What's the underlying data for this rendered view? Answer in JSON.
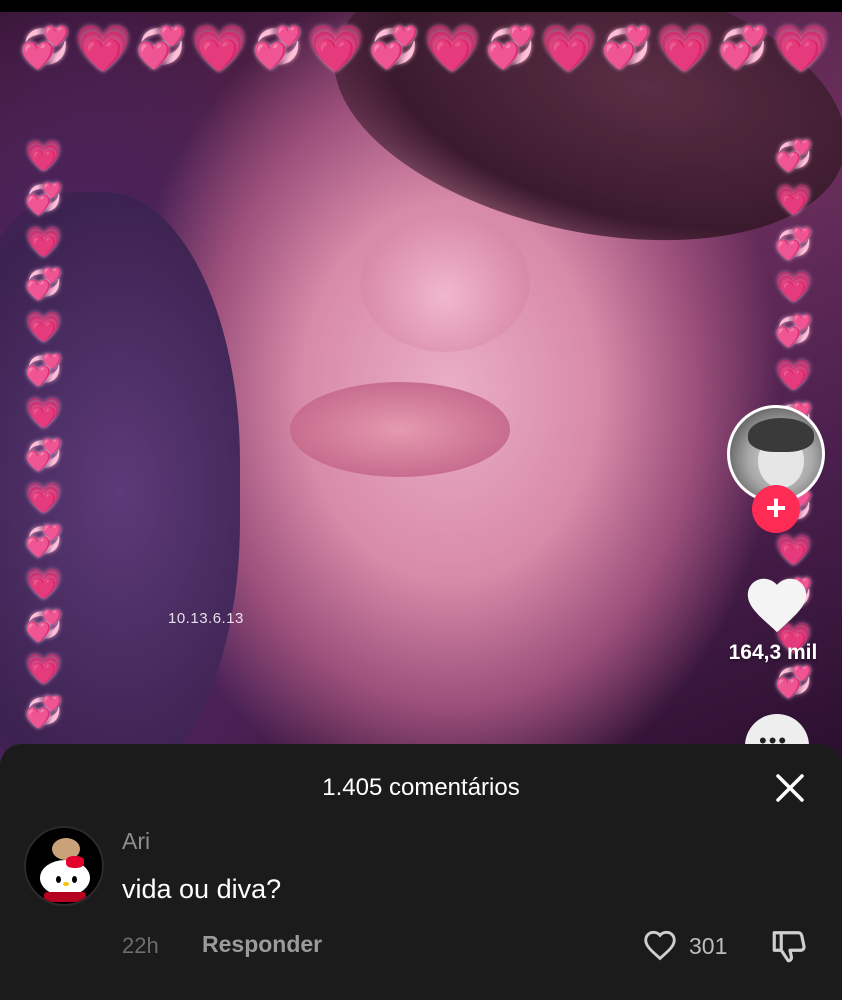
{
  "video": {
    "watermark": "10.13.6.13",
    "heart_icon": "pink-heart-emoji",
    "sparkle_heart_icon": "sparkling-heart-emoji"
  },
  "sidebar": {
    "avatar_icon": "creator-avatar",
    "follow_label": "+",
    "like_count": "164,3 mil",
    "comment_icon": "comment-bubble-icon"
  },
  "comments_sheet": {
    "title": "1.405 comentários",
    "close_icon": "close-icon",
    "comments": [
      {
        "username": "Ari",
        "text": "vida ou diva?",
        "time": "22h",
        "reply_label": "Responder",
        "like_count": "301"
      }
    ]
  },
  "colors": {
    "accent": "#fe2c55",
    "sheet_bg": "#1b1b1b",
    "heart_pink": "#ff5fae"
  }
}
